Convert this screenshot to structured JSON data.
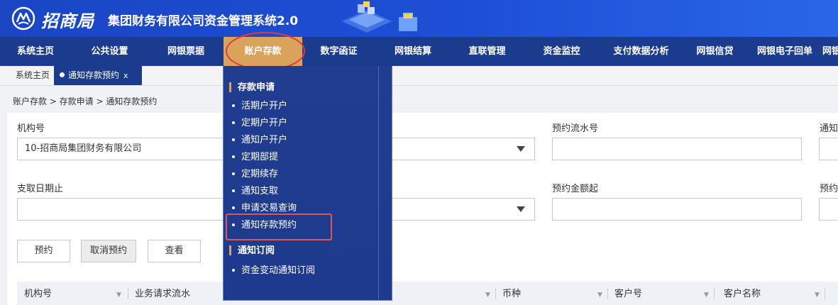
{
  "header": {
    "brand": "招商局",
    "system_title": "集团财务有限公司资金管理系统2.0"
  },
  "nav": {
    "items": [
      {
        "label": "系统主页"
      },
      {
        "label": "公共设置"
      },
      {
        "label": "网银票据"
      },
      {
        "label": "账户存款",
        "active": true
      },
      {
        "label": "数字函证"
      },
      {
        "label": "网银结算"
      },
      {
        "label": "直联管理"
      },
      {
        "label": "资金监控"
      },
      {
        "label": "支付数据分析"
      },
      {
        "label": "网银信贷"
      },
      {
        "label": "网银电子回单"
      },
      {
        "label": "网银"
      }
    ]
  },
  "tabs": {
    "home": "系统主页",
    "active": "通知存款预约",
    "close": "x"
  },
  "breadcrumb": "账户存款 > 存款申请 > 通知存款预约",
  "form": {
    "org_label": "机构号",
    "org_value": "10-招商局集团财务有限公司",
    "reserve_no_label": "预约流水号",
    "notice_label_cut": "通知",
    "end_date_label": "支取日期止",
    "amount_from_label": "预约金额起",
    "reserve_label_cut": "预约"
  },
  "buttons": {
    "reserve": "预约",
    "cancel_reserve": "取消预约",
    "view": "查看"
  },
  "table": {
    "headers": [
      "机构号",
      "业务请求流水",
      "币种",
      "客户号",
      "客户名称"
    ]
  },
  "dropdown": {
    "groups": [
      {
        "title": "存款申请",
        "items": [
          "活期户开户",
          "定期户开户",
          "通知户开户",
          "定期部提",
          "定期续存",
          "通知支取",
          "申请交易查询",
          "通知存款预约"
        ]
      },
      {
        "title": "通知订阅",
        "items": [
          "资金变动通知订阅"
        ]
      }
    ]
  },
  "colors": {
    "header_blue": "#1d4fd6",
    "nav_blue": "#1b3b8f",
    "active_gold": "#d9a35c",
    "highlight_red": "#e23a3a"
  }
}
